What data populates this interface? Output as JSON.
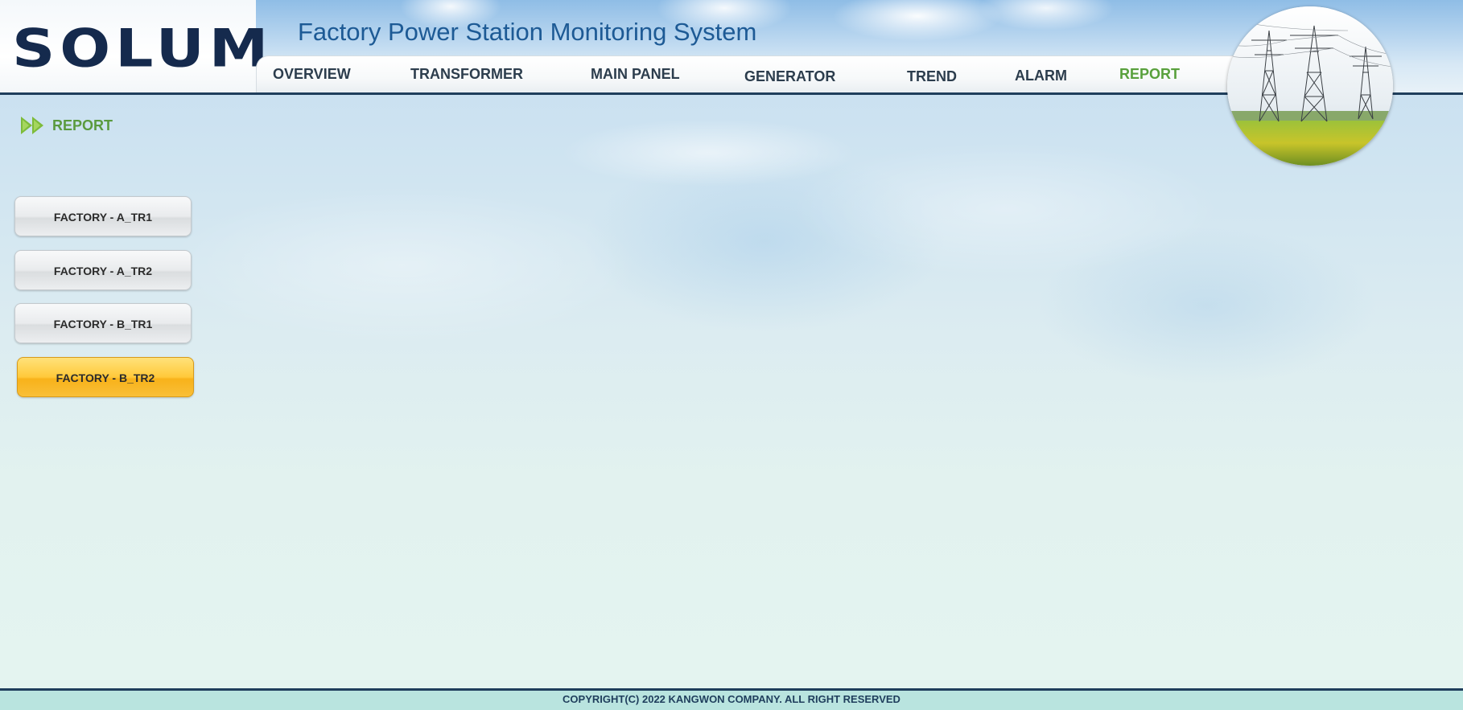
{
  "header": {
    "logo": "SOLUM",
    "title": "Factory Power Station Monitoring System"
  },
  "nav": {
    "items": [
      {
        "label": "OVERVIEW"
      },
      {
        "label": "TRANSFORMER"
      },
      {
        "label": "MAIN PANEL"
      },
      {
        "label": "GENERATOR"
      },
      {
        "label": "TREND"
      },
      {
        "label": "ALARM"
      },
      {
        "label": "REPORT"
      }
    ],
    "active": "REPORT"
  },
  "section": {
    "title": "REPORT",
    "icon": "fast-forward-icon"
  },
  "sidebar": {
    "buttons": [
      {
        "label": "FACTORY - A_TR1"
      },
      {
        "label": "FACTORY - A_TR2"
      },
      {
        "label": "FACTORY - B_TR1"
      },
      {
        "label": "FACTORY  - B_TR2"
      }
    ],
    "selected": "FACTORY  - B_TR2"
  },
  "footer": {
    "copyright": "COPYRIGHT(C) 2022 KANGWON COMPANY. ALL RIGHT RESERVED"
  },
  "colors": {
    "navy": "#1f3e5c",
    "title_blue": "#1d5a95",
    "active_green": "#58a03c",
    "selected_yellow": "#ffc93a"
  }
}
